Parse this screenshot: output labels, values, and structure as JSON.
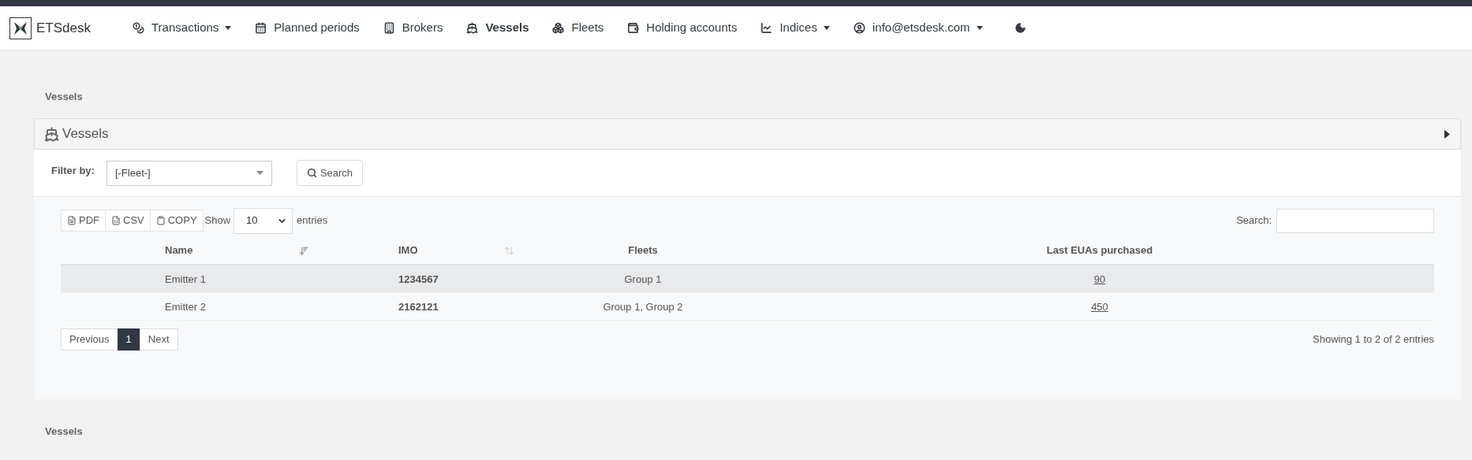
{
  "navbar": {
    "brand": "ETSdesk",
    "items": [
      {
        "kind": "coins",
        "label": "Transactions",
        "dropdown": true,
        "selected": false
      },
      {
        "kind": "calendar",
        "label": "Planned periods",
        "dropdown": false,
        "selected": false
      },
      {
        "kind": "building",
        "label": "Brokers",
        "dropdown": false,
        "selected": false
      },
      {
        "kind": "ship",
        "label": "Vessels",
        "dropdown": false,
        "selected": true
      },
      {
        "kind": "cubes",
        "label": "Fleets",
        "dropdown": false,
        "selected": false
      },
      {
        "kind": "wallet",
        "label": "Holding accounts",
        "dropdown": false,
        "selected": false
      },
      {
        "kind": "chart",
        "label": "Indices",
        "dropdown": true,
        "selected": false
      },
      {
        "kind": "user",
        "label": "info@etsdesk.com",
        "dropdown": true,
        "selected": false
      }
    ]
  },
  "breadcrumb": "Vessels",
  "card": {
    "title": "Vessels",
    "expanded": false,
    "filter": {
      "label": "Filter by:",
      "value": "[-Fleet-]",
      "button": "Search"
    },
    "export_buttons": [
      {
        "kind": "pdf",
        "label": "PDF"
      },
      {
        "kind": "csv",
        "label": "CSV"
      },
      {
        "kind": "copy",
        "label": "COPY"
      }
    ],
    "length": {
      "before": "Show",
      "value": "10",
      "after": "entries"
    },
    "search_label": "Search:",
    "table": {
      "columns": [
        {
          "kind": "sorted",
          "label": "Name"
        },
        {
          "kind": "sortable",
          "label": "IMO"
        },
        {
          "kind": "plain",
          "label": "Fleets"
        },
        {
          "kind": "plain",
          "label": "Last EUAs purchased"
        }
      ],
      "rows": [
        {
          "highlighted": true,
          "cells": [
            "Emitter 1",
            "1234567",
            "Group 1",
            "90"
          ]
        },
        {
          "highlighted": false,
          "cells": [
            "Emitter 2",
            "2162121",
            "Group 1, Group 2",
            "450"
          ]
        }
      ]
    },
    "pagination": [
      {
        "label": "Previous",
        "selected": false
      },
      {
        "label": "1",
        "selected": true
      },
      {
        "label": "Next",
        "selected": false
      }
    ],
    "info": "Showing 1 to 2 of 2 entries"
  },
  "footer": "Vessels"
}
